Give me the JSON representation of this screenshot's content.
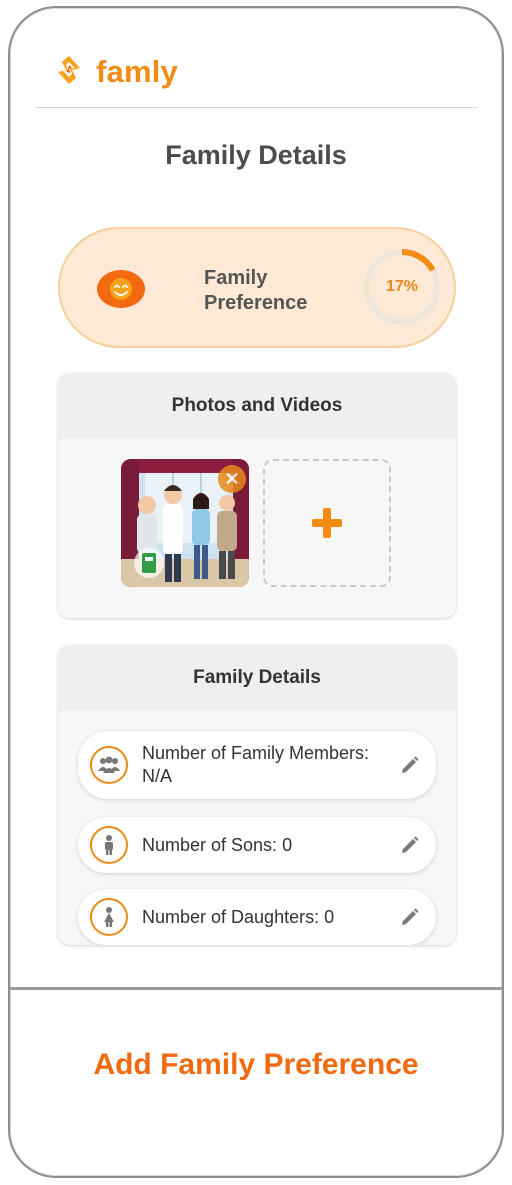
{
  "app": {
    "name": "famly",
    "logo_icon": "famly-logo-icon"
  },
  "page": {
    "title": "Family Details"
  },
  "preference_card": {
    "label": "Family Preference",
    "progress_fraction": 0.17,
    "progress_text": "17%",
    "icon": "smiley-face-icon"
  },
  "photos_section": {
    "title": "Photos and Videos",
    "items": [
      {
        "type": "image",
        "description_icon": "family-photo",
        "remove_icon": "close-icon"
      }
    ],
    "add_icon": "plus-icon"
  },
  "details_section": {
    "title": "Family Details",
    "rows": [
      {
        "icon": "group-icon",
        "text": "Number of Family Members: N/A",
        "edit_icon": "pencil-icon"
      },
      {
        "icon": "male-person-icon",
        "text": "Number of Sons: 0",
        "edit_icon": "pencil-icon"
      },
      {
        "icon": "female-person-icon",
        "text": "Number of Daughters: 0",
        "edit_icon": "pencil-icon"
      }
    ]
  },
  "cta": {
    "label": "Add Family Preference"
  },
  "colors": {
    "brand": "#f28c13",
    "accent": "#e8891b",
    "cta": "#f26a10",
    "pref_bg": "#fde9d4"
  }
}
